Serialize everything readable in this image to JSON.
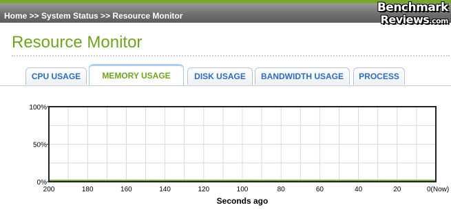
{
  "header": {
    "breadcrumb": "Home >> System Status >> Resource Monitor",
    "logo_line1": "Benchmark",
    "logo_line2": "Reviews",
    "logo_suffix": ".com",
    "accent_color": "#79a72b"
  },
  "page": {
    "title": "Resource Monitor",
    "title_color": "#6ea51e"
  },
  "tabs": [
    {
      "label": "CPU USAGE",
      "active": false
    },
    {
      "label": "MEMORY USAGE",
      "active": true
    },
    {
      "label": "DISK USAGE",
      "active": false
    },
    {
      "label": "BANDWIDTH USAGE",
      "active": false
    },
    {
      "label": "PROCESS",
      "active": false
    }
  ],
  "chart_data": {
    "type": "area",
    "title": "",
    "xlabel": "Seconds ago",
    "ylabel": "",
    "x_ticks": [
      "200",
      "180",
      "160",
      "140",
      "120",
      "100",
      "80",
      "60",
      "40",
      "20",
      "0(Now)"
    ],
    "y_ticks": [
      "100%",
      "50%",
      "0%"
    ],
    "xlim": [
      200,
      0
    ],
    "ylim": [
      0,
      100
    ],
    "grid": true,
    "series": [
      {
        "color": "#6eaa3c",
        "x": [
          200,
          0
        ],
        "values": [
          2,
          2
        ]
      }
    ]
  }
}
